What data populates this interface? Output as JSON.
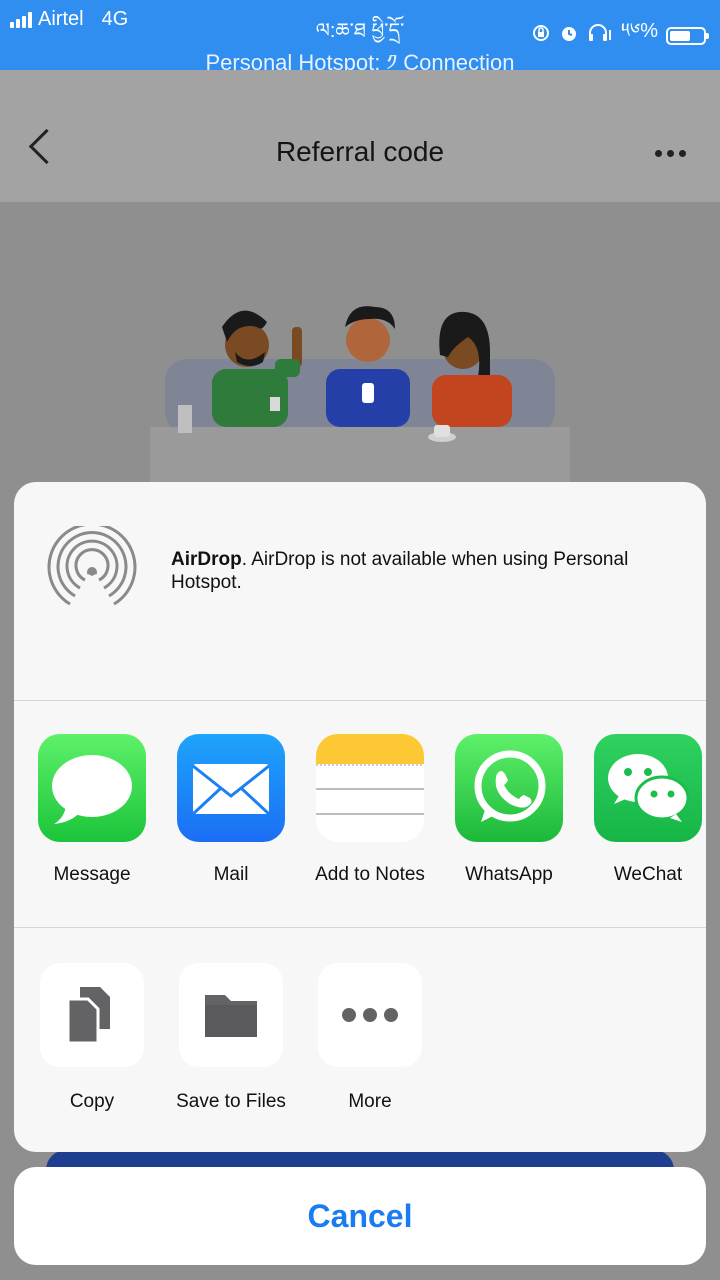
{
  "status_bar": {
    "carrier": "Airtel",
    "network": "4G",
    "center_text": "ལ:ཆ་ཐ ཕྱི་དྲོ་",
    "battery_text": "༥༦%",
    "battery_level": 0.56,
    "hotspot": "Personal Hotspot: ༡ Connection"
  },
  "navbar": {
    "title": "Referral code"
  },
  "share_sheet": {
    "airdrop": {
      "title": "AirDrop",
      "message": ". AirDrop is not available when using Personal Hotspot."
    },
    "apps": [
      {
        "label": "Message",
        "icon": "message-app-icon"
      },
      {
        "label": "Mail",
        "icon": "mail-app-icon"
      },
      {
        "label": "Add to Notes",
        "icon": "notes-app-icon"
      },
      {
        "label": "WhatsApp",
        "icon": "whatsapp-app-icon"
      },
      {
        "label": "WeChat",
        "icon": "wechat-app-icon"
      }
    ],
    "actions": [
      {
        "label": "Copy",
        "icon": "copy-icon"
      },
      {
        "label": "Save to Files",
        "icon": "folder-icon"
      },
      {
        "label": "More",
        "icon": "more-icon"
      }
    ],
    "cancel_label": "Cancel"
  },
  "colors": {
    "status_bar": "#2f8ef0",
    "cancel_text": "#1a7cf0"
  }
}
